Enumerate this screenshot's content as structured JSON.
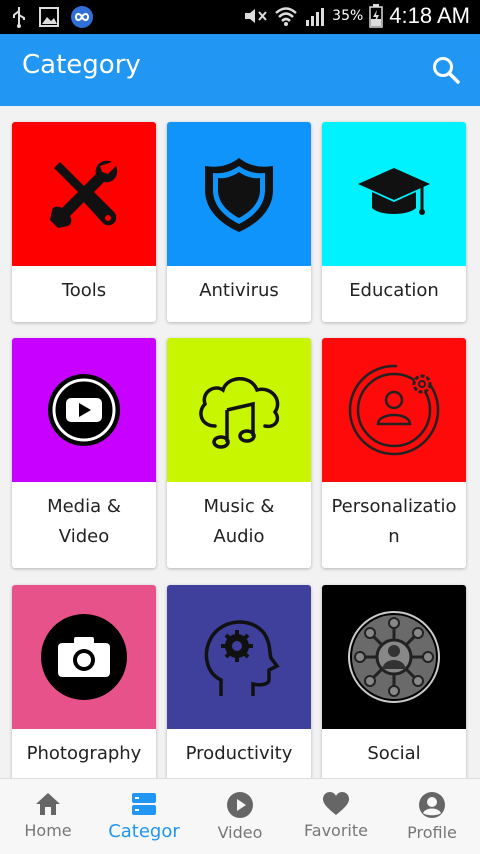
{
  "status_bar": {
    "battery_percent": "35%",
    "time": "4:18 AM",
    "left_icons": [
      "usb-icon",
      "image-icon",
      "infinity-app-icon"
    ],
    "right_icons": [
      "mute-icon",
      "wifi-icon",
      "signal-icon",
      "battery-icon"
    ]
  },
  "app_bar": {
    "title": "Category",
    "color": "#2196f3",
    "search_icon": "search-icon"
  },
  "categories": [
    {
      "label": "Tools",
      "color": "#ff0000",
      "icon": "tools-icon"
    },
    {
      "label": "Antivirus",
      "color": "#0f94fb",
      "icon": "shield-icon"
    },
    {
      "label": "Education",
      "color": "#00f2ff",
      "icon": "graduation-cap-icon"
    },
    {
      "label": "Media &",
      "label2": "Video",
      "color": "#c800ff",
      "icon": "play-icon"
    },
    {
      "label": "Music &",
      "label2": "Audio",
      "color": "#c8f500",
      "icon": "cloud-music-icon"
    },
    {
      "label": "Personalizatio",
      "label2": "n",
      "color": "#ff0a0a",
      "icon": "user-gear-icon"
    },
    {
      "label": "Photography",
      "color": "#e8528a",
      "icon": "camera-icon"
    },
    {
      "label": "Productivity",
      "color": "#3f3f9c",
      "icon": "head-gear-icon"
    },
    {
      "label": "Social",
      "color": "#000000",
      "icon": "social-network-icon"
    }
  ],
  "bottom_nav": {
    "items": [
      {
        "label": "Home",
        "icon": "home-icon"
      },
      {
        "label": "Categor",
        "icon": "category-icon",
        "active": true
      },
      {
        "label": "Video",
        "icon": "play-circle-icon"
      },
      {
        "label": "Favorite",
        "icon": "heart-icon"
      },
      {
        "label": "Profile",
        "icon": "profile-icon"
      }
    ],
    "active_color": "#2196f3",
    "inactive_color": "#777777"
  }
}
